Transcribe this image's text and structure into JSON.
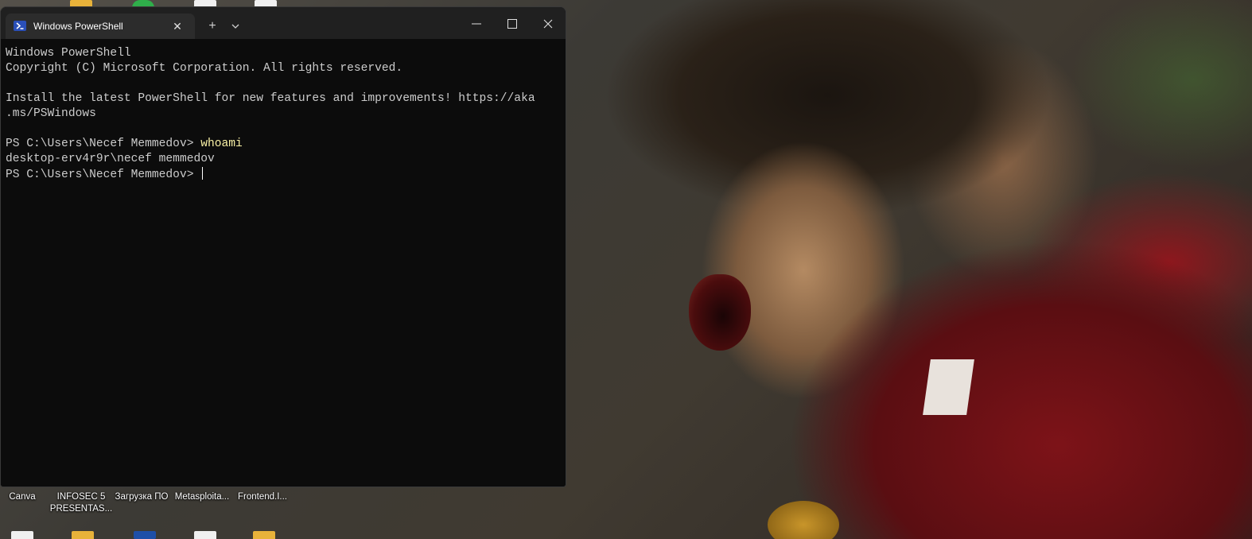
{
  "window": {
    "tab_title": "Windows PowerShell",
    "tab_icon": "powershell-icon",
    "new_tab_label": "+",
    "close_tab_label": "✕"
  },
  "console": {
    "lines": [
      "Windows PowerShell",
      "Copyright (C) Microsoft Corporation. All rights reserved.",
      "",
      "Install the latest PowerShell for new features and improvements! https://aka",
      ".ms/PSWindows",
      ""
    ],
    "prompt1": "PS C:\\Users\\Necef Memmedov> ",
    "command1": "whoami",
    "output1": "desktop-erv4r9r\\necef memmedov",
    "prompt2": "PS C:\\Users\\Necef Memmedov> "
  },
  "desktop": {
    "icons": [
      {
        "label_line1": "Canva",
        "label_line2": ""
      },
      {
        "label_line1": "INFOSEC 5",
        "label_line2": "PRESENTAS..."
      },
      {
        "label_line1": "Загрузка ПО",
        "label_line2": ""
      },
      {
        "label_line1": "Metasploita...",
        "label_line2": ""
      },
      {
        "label_line1": "Frontend.I...",
        "label_line2": ""
      }
    ]
  },
  "colors": {
    "terminal_bg": "#0c0c0c",
    "terminal_text": "#cccccc",
    "command_text": "#f9f1a5",
    "titlebar": "#202020"
  }
}
